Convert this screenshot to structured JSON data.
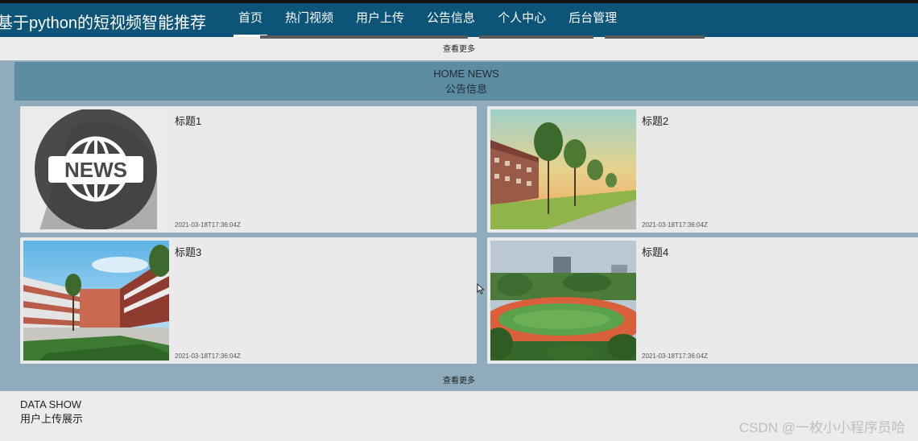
{
  "header": {
    "site_title": "基于python的短视频智能推荐",
    "nav": [
      {
        "label": "首页",
        "active": true
      },
      {
        "label": "热门视频"
      },
      {
        "label": "用户上传"
      },
      {
        "label": "公告信息"
      },
      {
        "label": "个人中心"
      },
      {
        "label": "后台管理"
      }
    ]
  },
  "top_more": "查看更多",
  "news": {
    "heading_en": "HOME NEWS",
    "heading_cn": "公告信息",
    "items": [
      {
        "title": "标题1",
        "date": "2021-03-18T17:36:04Z",
        "image": "news-globe-icon"
      },
      {
        "title": "标题2",
        "date": "2021-03-18T17:36:04Z",
        "image": "campus-sunset-photo"
      },
      {
        "title": "标题3",
        "date": "2021-03-18T17:36:04Z",
        "image": "campus-courtyard-photo"
      },
      {
        "title": "标题4",
        "date": "2021-03-18T17:36:04Z",
        "image": "sports-field-photo"
      }
    ],
    "more": "查看更多"
  },
  "data_show": {
    "heading_en": "DATA SHOW",
    "heading_cn": "用户上传展示"
  },
  "watermark": "CSDN @一枚小小程序员哈",
  "colors": {
    "navbar": "#0d5479",
    "section_bg": "#8fabbc",
    "section_header": "#5e8da3",
    "card_bg": "#eaeaea"
  }
}
